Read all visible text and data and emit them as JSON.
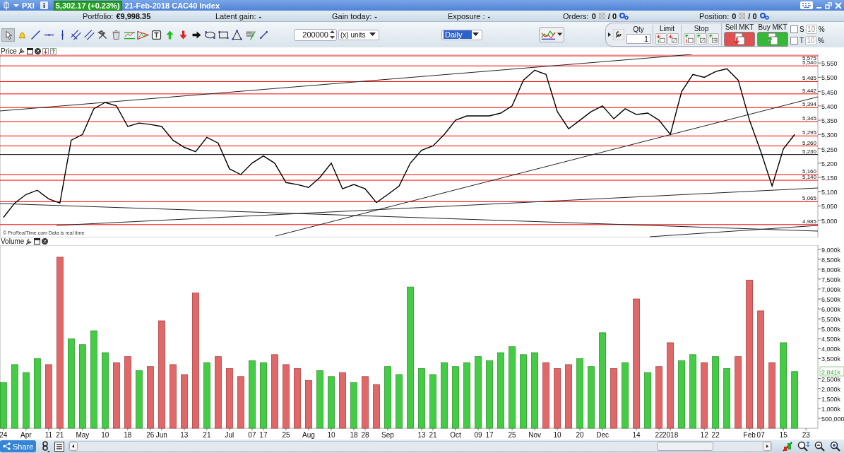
{
  "title_bar": {
    "symbol": "PXI",
    "quote": "5,302.17 (+0.23%)",
    "description": "21-Feb-2018 CAC40 Index"
  },
  "account_bar": [
    {
      "label": "Portfolio:",
      "value": "€9,998.35"
    },
    {
      "label": "Latent gain:",
      "value": "-"
    },
    {
      "label": "Gain today:",
      "value": "-"
    },
    {
      "label": "Exposure :",
      "value": "-"
    }
  ],
  "orders": {
    "label": "Orders:",
    "count": "0",
    "total": "/ 0"
  },
  "position": {
    "label": "Position:",
    "count": "0",
    "total": "/ 0"
  },
  "toolbar": {
    "quantity": "200000",
    "units": "(x) units",
    "period": "Daily"
  },
  "order_panel": {
    "qty_label": "Qty",
    "qty": "1",
    "limit_label": "Limit",
    "stop_label": "Stop",
    "sell_label": "Sell MKT",
    "buy_label": "Buy MKT",
    "options": [
      {
        "label": "S",
        "placeholder": "10",
        "unit": "%",
        "checked": false
      },
      {
        "label": "T",
        "placeholder": "10",
        "unit": "%",
        "checked": false
      }
    ]
  },
  "price_panel": {
    "title": "Price",
    "copyright": "© ProRealTime.com Data is real time",
    "chart_data": {
      "type": "line",
      "ylim": [
        4940,
        5580
      ],
      "series": [
        {
          "color": "#000000",
          "values": [
            5010,
            5060,
            5090,
            5105,
            5075,
            5060,
            5280,
            5300,
            5390,
            5412,
            5400,
            5328,
            5340,
            5335,
            5328,
            5280,
            5255,
            5240,
            5290,
            5270,
            5180,
            5160,
            5200,
            5225,
            5200,
            5132,
            5125,
            5115,
            5150,
            5200,
            5110,
            5125,
            5110,
            5062,
            5090,
            5120,
            5200,
            5245,
            5260,
            5300,
            5350,
            5365,
            5365,
            5365,
            5375,
            5400,
            5490,
            5525,
            5510,
            5380,
            5320,
            5350,
            5380,
            5400,
            5355,
            5390,
            5370,
            5375,
            5350,
            5300,
            5450,
            5510,
            5500,
            5520,
            5530,
            5490,
            5350,
            5240,
            5120,
            5250,
            5300,
            null
          ]
        }
      ],
      "yticks": [
        {
          "value": 5000,
          "label": "5,000"
        },
        {
          "value": 5050,
          "label": "5,050"
        },
        {
          "value": 5100,
          "label": "5,100"
        },
        {
          "value": 5150,
          "label": "5,150"
        },
        {
          "value": 5200,
          "label": "5,200"
        },
        {
          "value": 5250,
          "label": "5,250"
        },
        {
          "value": 5300,
          "label": "5,300"
        },
        {
          "value": 5350,
          "label": "5,350"
        },
        {
          "value": 5400,
          "label": "5,400"
        },
        {
          "value": 5450,
          "label": "5,450"
        },
        {
          "value": 5500,
          "label": "5,500"
        },
        {
          "value": 5550,
          "label": "5,550"
        }
      ],
      "ref_lines": [
        {
          "axis": "y",
          "value": 5575,
          "label": "5,575",
          "color": "#ff0000"
        },
        {
          "axis": "y",
          "value": 5540,
          "label": "5,540",
          "color": "#ff0000"
        },
        {
          "axis": "y",
          "value": 5485,
          "label": "5,485",
          "color": "#ff0000"
        },
        {
          "axis": "y",
          "value": 5442,
          "label": "5,442",
          "color": "#ff0000"
        },
        {
          "axis": "y",
          "value": 5394,
          "label": "5,394",
          "color": "#ff0000"
        },
        {
          "axis": "y",
          "value": 5345,
          "label": "5,345",
          "color": "#ff0000"
        },
        {
          "axis": "y",
          "value": 5295,
          "label": "5,295",
          "color": "#ff0000"
        },
        {
          "axis": "y",
          "value": 5260,
          "label": "5,260",
          "color": "#ff0000"
        },
        {
          "axis": "y",
          "value": 5230,
          "label": "5,230",
          "color": "#000000"
        },
        {
          "axis": "y",
          "value": 5160,
          "label": "5,160",
          "color": "#ff0000"
        },
        {
          "axis": "y",
          "value": 5140,
          "label": "5,140",
          "color": "#ff0000"
        },
        {
          "axis": "y",
          "value": 5065,
          "label": "5,065",
          "color": "#ff0000"
        },
        {
          "axis": "y",
          "value": 4985,
          "label": "4,985",
          "color": "#ff0000"
        }
      ]
    }
  },
  "volume_panel": {
    "title": "Volume",
    "chart_data": {
      "type": "bar",
      "ylim": [
        0,
        9200000
      ],
      "categories": [
        "24",
        null,
        "Apr",
        null,
        "11",
        "21",
        null,
        "May",
        null,
        "10",
        null,
        "18",
        null,
        "26",
        "Jun",
        null,
        "13",
        null,
        "21",
        null,
        "Jul",
        null,
        "07",
        "17",
        null,
        "25",
        null,
        "Aug",
        null,
        "10",
        null,
        "18",
        "28",
        null,
        "Sep",
        null,
        null,
        "13",
        "21",
        null,
        "Oct",
        null,
        "09",
        "17",
        null,
        "25",
        null,
        "Nov",
        null,
        "10",
        null,
        "20",
        null,
        "Dec",
        null,
        null,
        "14",
        null,
        "22",
        "2018",
        null,
        null,
        "12",
        "22",
        null,
        null,
        "Feb",
        "07",
        null,
        "15",
        null,
        "23"
      ],
      "series": [
        {
          "values": [
            2300000,
            3200000,
            2800000,
            3500000,
            3200000,
            8600000,
            4500000,
            4200000,
            4900000,
            3800000,
            3300000,
            3600000,
            2900000,
            3100000,
            5400000,
            3200000,
            2700000,
            6800000,
            3300000,
            3600000,
            3000000,
            2600000,
            3400000,
            3300000,
            3700000,
            3200000,
            3000000,
            2400000,
            2900000,
            2600000,
            2800000,
            2300000,
            2600000,
            2200000,
            3100000,
            2700000,
            7100000,
            3000000,
            2700000,
            3300000,
            3100000,
            3300000,
            3600000,
            3400000,
            3800000,
            4100000,
            3700000,
            3800000,
            3300000,
            3000000,
            3200000,
            3500000,
            3100000,
            4800000,
            3000000,
            3300000,
            6500000,
            2800000,
            3100000,
            4300000,
            3400000,
            3700000,
            3300000,
            3600000,
            3000000,
            3600000,
            7450000,
            5900000,
            3300000,
            4300000,
            2850000,
            null
          ]
        }
      ],
      "yticks": [
        {
          "value": 500000,
          "label": "500,000"
        },
        {
          "value": 1000000,
          "label": "1,000k"
        },
        {
          "value": 1500000,
          "label": "1,500k"
        },
        {
          "value": 2000000,
          "label": "2,000k"
        },
        {
          "value": 2500000,
          "label": "2,500k"
        },
        {
          "value": 3500000,
          "label": "3,500k"
        },
        {
          "value": 4000000,
          "label": "4,000k"
        },
        {
          "value": 4500000,
          "label": "4,500k"
        },
        {
          "value": 5000000,
          "label": "5,000k"
        },
        {
          "value": 5500000,
          "label": "5,500k"
        },
        {
          "value": 6000000,
          "label": "6,000k"
        },
        {
          "value": 6500000,
          "label": "6,500k"
        },
        {
          "value": 7000000,
          "label": "7,000k"
        },
        {
          "value": 7500000,
          "label": "7,500k"
        },
        {
          "value": 8000000,
          "label": "8,000k"
        },
        {
          "value": 8500000,
          "label": "8,500k"
        },
        {
          "value": 9000000,
          "label": "9,000k"
        }
      ],
      "annotations": [
        {
          "y": 2841000,
          "text": "2,841k"
        }
      ]
    }
  },
  "bottom_bar": {
    "share": "Share"
  }
}
